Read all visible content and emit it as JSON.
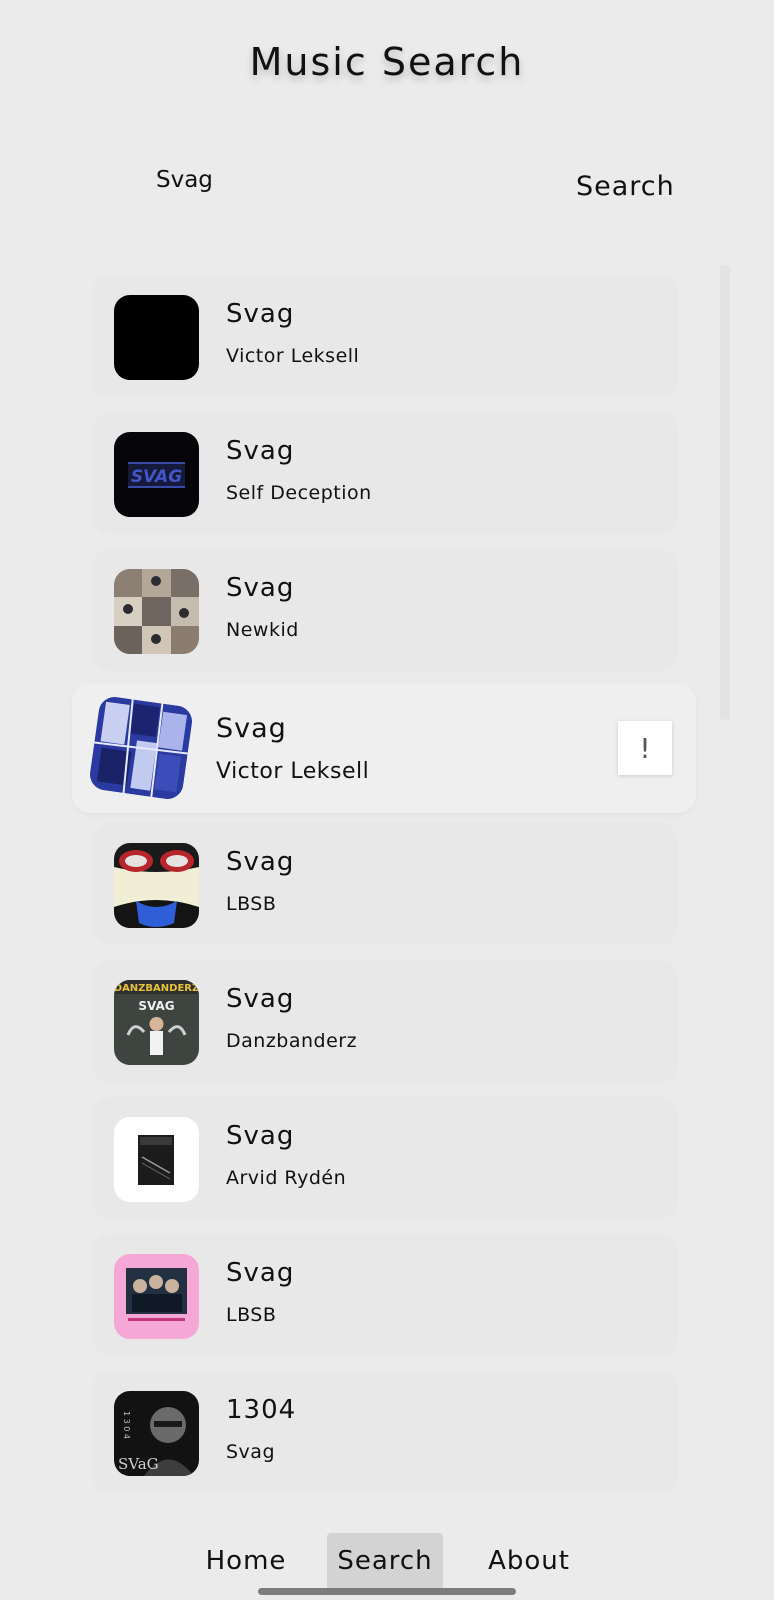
{
  "header": {
    "title": "Music Search"
  },
  "search": {
    "query": "Svag",
    "button_label": "Search"
  },
  "results": [
    {
      "title": "Svag",
      "artist": "Victor Leksell",
      "cover": "black-square"
    },
    {
      "title": "Svag",
      "artist": "Self Deception",
      "cover": "svag-logo-dark"
    },
    {
      "title": "Svag",
      "artist": "Newkid",
      "cover": "photo-grid"
    },
    {
      "title": "Svag",
      "artist": "Victor Leksell",
      "cover": "blue-collage",
      "selected": true,
      "action_label": "!"
    },
    {
      "title": "Svag",
      "artist": "LBSB",
      "cover": "face-sunglasses"
    },
    {
      "title": "Svag",
      "artist": "Danzbanderz",
      "cover": "danzbanderz-chalkboard",
      "cover_text_top": "DANZBANDERZ",
      "cover_text_mid": "SVAG"
    },
    {
      "title": "Svag",
      "artist": "Arvid Rydén",
      "cover": "piano-white"
    },
    {
      "title": "Svag",
      "artist": "LBSB",
      "cover": "pink-band"
    },
    {
      "title": "1304",
      "artist": "Svag",
      "cover": "bw-portrait",
      "cover_text": "SVaG",
      "cover_digits": "1 3 0 4"
    }
  ],
  "nav": {
    "items": [
      {
        "label": "Home",
        "active": false
      },
      {
        "label": "Search",
        "active": true
      },
      {
        "label": "About",
        "active": false
      }
    ]
  },
  "colors": {
    "background": "#ebebeb",
    "card": "#e8e8e8",
    "selected_card": "#efefef",
    "active_nav": "#d3d3d3"
  }
}
